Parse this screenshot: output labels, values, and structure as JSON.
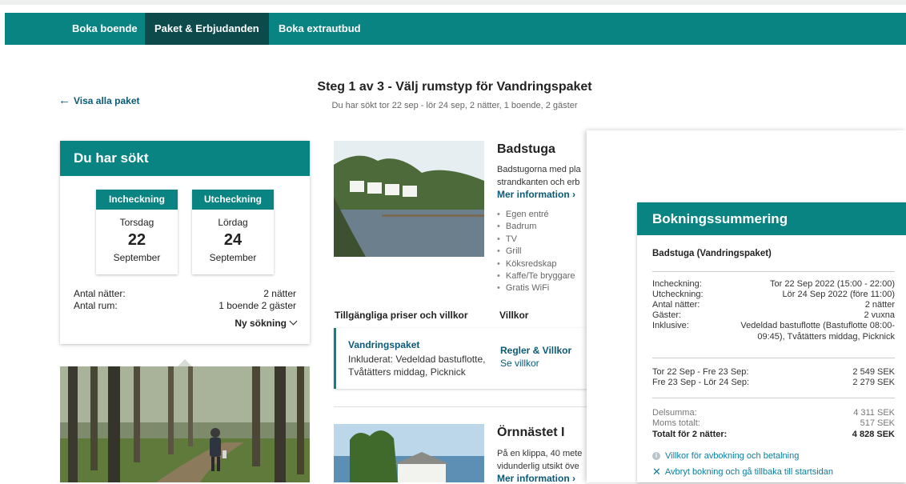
{
  "nav": {
    "items": [
      "Boka boende",
      "Paket & Erbjudanden",
      "Boka extrautbud"
    ],
    "active_index": 1
  },
  "back_link": "Visa alla paket",
  "page": {
    "title": "Steg 1 av 3 - Välj rumstyp för Vandringspaket",
    "subtitle": "Du har sökt tor 22 sep - lör 24 sep, 2 nätter, 1 boende, 2 gäster"
  },
  "search": {
    "heading": "Du har sökt",
    "checkin": {
      "label": "Incheckning",
      "weekday": "Torsdag",
      "day": "22",
      "month": "September"
    },
    "checkout": {
      "label": "Utcheckning",
      "weekday": "Lördag",
      "day": "24",
      "month": "September"
    },
    "nights_label": "Antal nätter:",
    "nights_value": "2 nätter",
    "rooms_label": "Antal rum:",
    "rooms_value": "1 boende 2 gäster",
    "new_search": "Ny sökning"
  },
  "rooms": [
    {
      "title": "Badstuga",
      "desc_line1": "Badstugorna med pla",
      "desc_line2": "strandkanten och erb",
      "more": "Mer information ›",
      "amenities": [
        "Egen entré",
        "Badrum",
        "TV",
        "Grill",
        "Köksredskap",
        "Kaffe/Te bryggare",
        "Gratis WiFi"
      ]
    },
    {
      "title": "Örnnästet I",
      "desc_line1": "På en klippa, 40 mete",
      "desc_line2": "vidunderlig utsikt öve",
      "more": "Mer information ›"
    }
  ],
  "prices": {
    "col1": "Tillgängliga priser och villkor",
    "col2": "Villkor",
    "package_name": "Vandringspaket",
    "package_desc_line1": "Inkluderat: Vedeldad bastuflotte,",
    "package_desc_line2": "Tvåtätters middag, Picknick",
    "rules": "Regler & Villkor",
    "see_terms": "Se villkor"
  },
  "summary": {
    "heading": "Bokningssummering",
    "room": "Badstuga (Vandringspaket)",
    "rows": [
      {
        "k": "Incheckning:",
        "v": "Tor 22 Sep 2022 (15:00 - 22:00)"
      },
      {
        "k": "Utcheckning:",
        "v": "Lör 24 Sep 2022 (före 11:00)"
      },
      {
        "k": "Antal nätter:",
        "v": "2 nätter"
      },
      {
        "k": "Gäster:",
        "v": "2 vuxna"
      }
    ],
    "incl_label": "Inklusive:",
    "incl_line1": "Vedeldad bastuflotte (Bastuflotte 08:00-",
    "incl_line2": "09:45), Tvåtätters middag, Picknick",
    "nightly": [
      {
        "k": "Tor 22 Sep - Fre 23 Sep:",
        "v": "2 549 SEK"
      },
      {
        "k": "Fre 23 Sep - Lör 24 Sep:",
        "v": "2 279 SEK"
      }
    ],
    "subtotal_label": "Delsumma:",
    "subtotal": "4 311 SEK",
    "vat_label": "Moms totalt:",
    "vat": "517 SEK",
    "total_label": "Totalt för 2 nätter:",
    "total": "4 828 SEK",
    "cancel_terms": "Villkor för avbokning och betalning",
    "abort": "Avbryt bokning och gå tillbaka till startsidan"
  },
  "colors": {
    "accent": "#0a8482",
    "nav_active": "#0c4a4c",
    "link": "#0a5a78"
  }
}
